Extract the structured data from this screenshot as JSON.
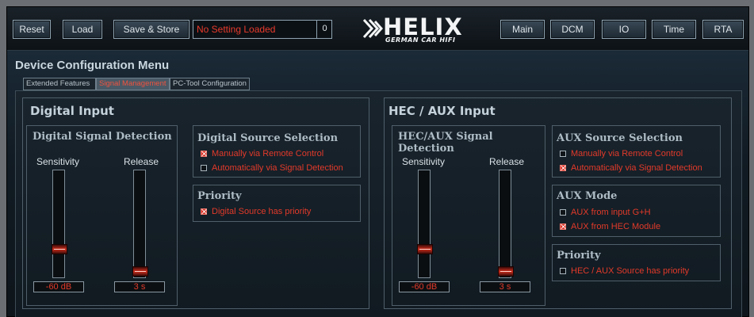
{
  "toolbar": {
    "reset": "Reset",
    "load": "Load",
    "save_store": "Save & Store",
    "status": "No Setting Loaded",
    "count": "0",
    "nav": [
      "Main",
      "DCM",
      "IO",
      "Time",
      "RTA"
    ]
  },
  "logo": {
    "name": "HELIX",
    "tagline": "GERMAN CAR HIFI"
  },
  "page_title": "Device Configuration Menu",
  "tabs": [
    {
      "label": "Extended Features",
      "active": false
    },
    {
      "label": "Signal Management",
      "active": true
    },
    {
      "label": "PC-Tool Configuration",
      "active": false
    }
  ],
  "digital": {
    "title": "Digital Input",
    "detection": {
      "title": "Digital Signal Detection",
      "sensitivity_label": "Sensitivity",
      "release_label": "Release",
      "sensitivity_value": "-60 dB",
      "release_value": "3 s"
    },
    "source": {
      "title": "Digital Source Selection",
      "options": [
        {
          "label": "Manually via Remote Control",
          "checked": true
        },
        {
          "label": "Automatically via Signal Detection",
          "checked": false
        }
      ]
    },
    "priority": {
      "title": "Priority",
      "options": [
        {
          "label": "Digital Source has priority",
          "checked": true
        }
      ]
    }
  },
  "hec": {
    "title": "HEC / AUX Input",
    "detection": {
      "title": "HEC/AUX Signal Detection",
      "sensitivity_label": "Sensitivity",
      "release_label": "Release",
      "sensitivity_value": "-60 dB",
      "release_value": "3 s"
    },
    "source": {
      "title": "AUX Source Selection",
      "options": [
        {
          "label": "Manually via Remote Control",
          "checked": false
        },
        {
          "label": "Automatically via Signal Detection",
          "checked": true
        }
      ]
    },
    "mode": {
      "title": "AUX Mode",
      "options": [
        {
          "label": "AUX from input G+H",
          "checked": false
        },
        {
          "label": "AUX from HEC Module",
          "checked": true
        }
      ]
    },
    "priority": {
      "title": "Priority",
      "options": [
        {
          "label": "HEC / AUX Source has priority",
          "checked": false
        }
      ]
    }
  }
}
